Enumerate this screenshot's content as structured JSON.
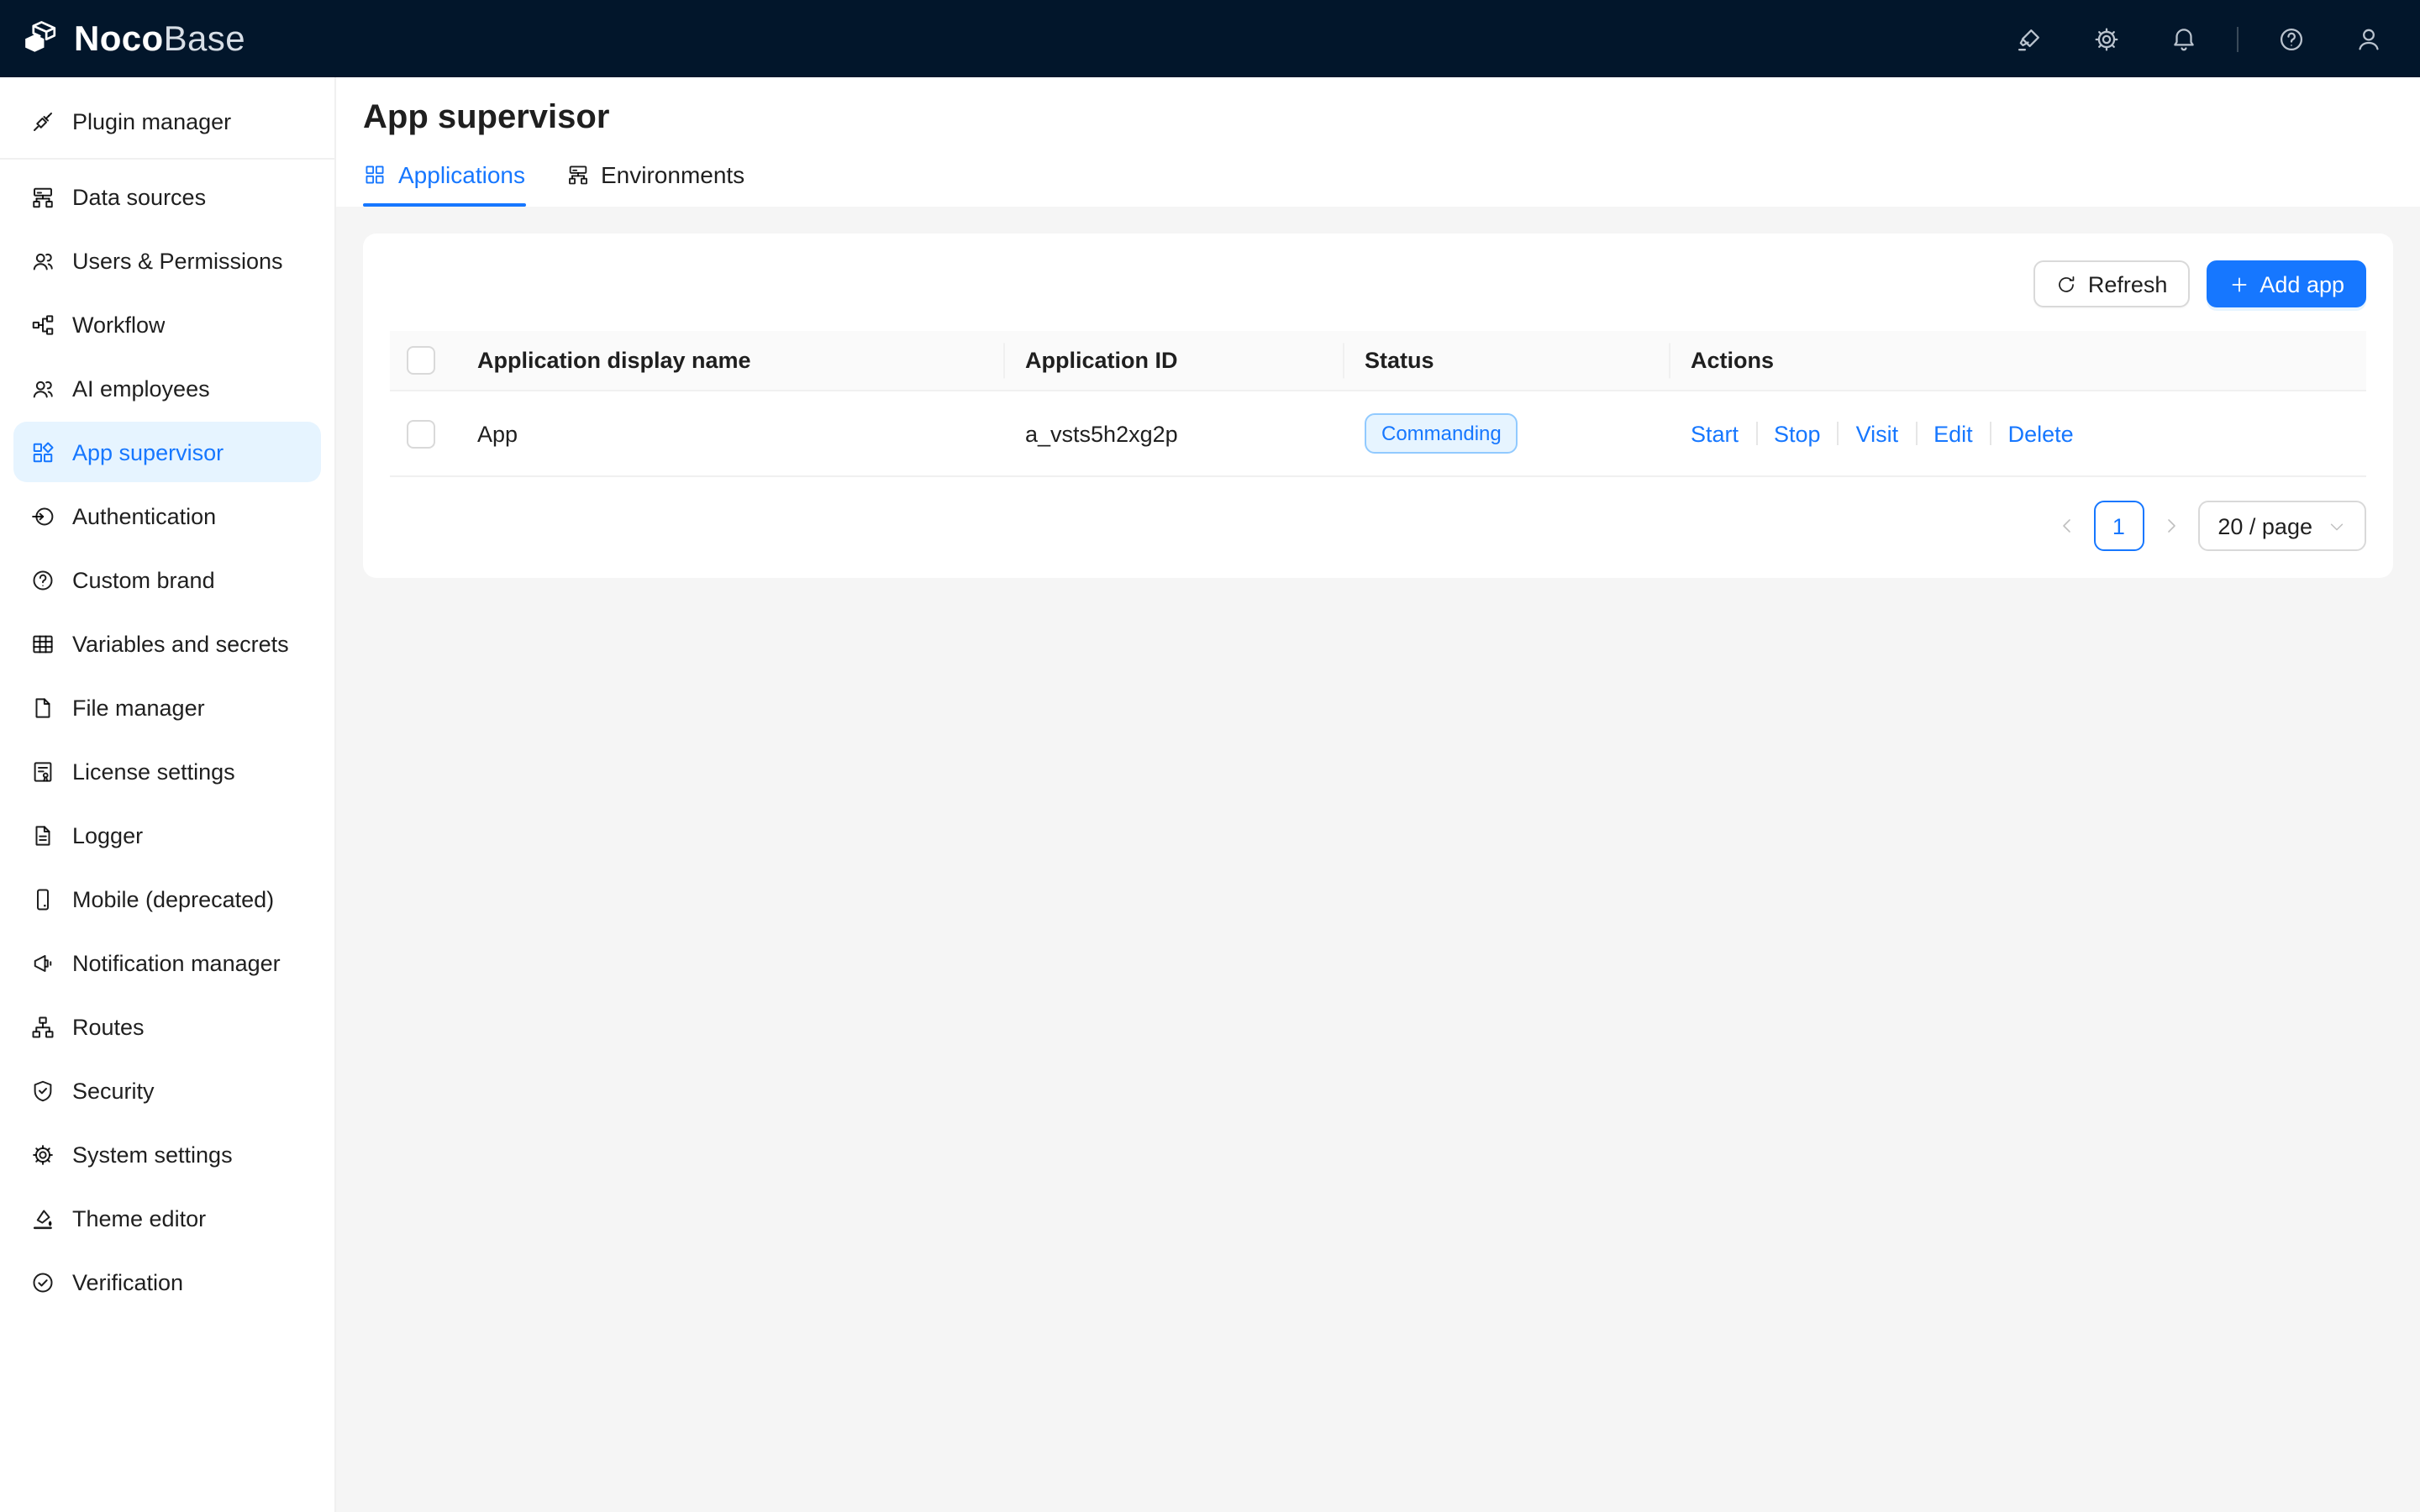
{
  "topbar": {
    "logo": {
      "primary": "Noco",
      "secondary": "Base"
    },
    "icons": [
      "highlighter-icon",
      "gear-icon",
      "bell-icon",
      "help-icon",
      "user-icon"
    ]
  },
  "sidebar": {
    "items": [
      {
        "label": "Plugin manager",
        "icon": "api",
        "divider_after": true
      },
      {
        "label": "Data sources",
        "icon": "cluster"
      },
      {
        "label": "Users & Permissions",
        "icon": "team"
      },
      {
        "label": "Workflow",
        "icon": "partition"
      },
      {
        "label": "AI employees",
        "icon": "team"
      },
      {
        "label": "App supervisor",
        "icon": "appstore-diamond",
        "active": true
      },
      {
        "label": "Authentication",
        "icon": "login"
      },
      {
        "label": "Custom brand",
        "icon": "question-circle"
      },
      {
        "label": "Variables and secrets",
        "icon": "table"
      },
      {
        "label": "File manager",
        "icon": "file"
      },
      {
        "label": "License settings",
        "icon": "certificate"
      },
      {
        "label": "Logger",
        "icon": "file-text"
      },
      {
        "label": "Mobile (deprecated)",
        "icon": "mobile"
      },
      {
        "label": "Notification manager",
        "icon": "megaphone"
      },
      {
        "label": "Routes",
        "icon": "apartment"
      },
      {
        "label": "Security",
        "icon": "shield-check"
      },
      {
        "label": "System settings",
        "icon": "gear"
      },
      {
        "label": "Theme editor",
        "icon": "paint"
      },
      {
        "label": "Verification",
        "icon": "check-circle"
      }
    ]
  },
  "page": {
    "title": "App supervisor",
    "tabs": [
      {
        "label": "Applications",
        "icon": "appstore-grid",
        "active": true
      },
      {
        "label": "Environments",
        "icon": "cluster",
        "active": false
      }
    ]
  },
  "toolbar": {
    "refresh_label": "Refresh",
    "add_app_label": "Add app"
  },
  "table": {
    "columns": [
      "Application display name",
      "Application ID",
      "Status",
      "Actions"
    ],
    "rows": [
      {
        "display_name": "App",
        "application_id": "a_vsts5h2xg2p",
        "status": "Commanding",
        "actions": [
          "Start",
          "Stop",
          "Visit",
          "Edit",
          "Delete"
        ]
      }
    ]
  },
  "pagination": {
    "current_page": "1",
    "page_size": "20 / page"
  },
  "colors": {
    "accent": "#1677ff",
    "topbar_bg": "#02162b",
    "active_item_bg": "#e6f4ff",
    "status_badge_bg": "#e6f4ff",
    "status_badge_border": "#91caff",
    "content_bg": "#f5f5f5",
    "table_header_bg": "#fafafa"
  }
}
